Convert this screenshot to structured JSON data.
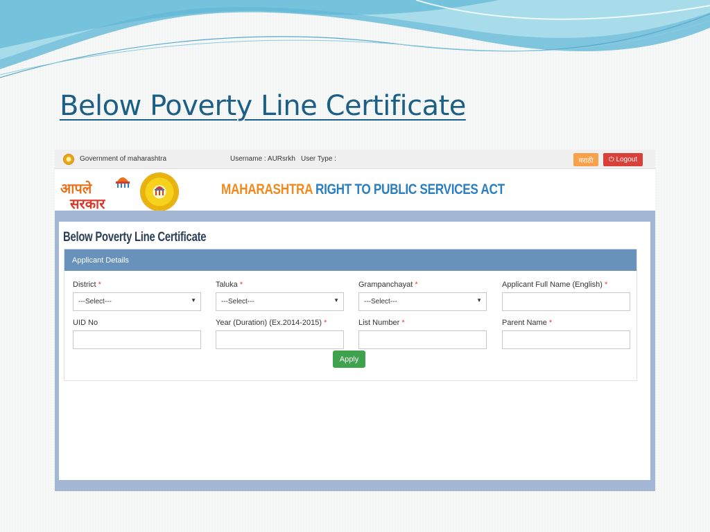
{
  "slide": {
    "title": "Below Poverty Line Certificate"
  },
  "topbar": {
    "gov_text": "Government of maharashtra",
    "username_text": "Username : AURsrkh",
    "user_type_text": "User Type :",
    "marathi_button": "मराठी",
    "logout_button": "⏻ Logout"
  },
  "brand": {
    "logo_line1": "आपले",
    "logo_line2": "सरकार",
    "tagline_orange": "MAHARASHTRA",
    "tagline_blue": " RIGHT TO PUBLIC SERVICES ACT"
  },
  "page": {
    "heading": "Below Poverty Line Certificate"
  },
  "panel": {
    "title": "Applicant Details",
    "fields": {
      "district": {
        "label": "District",
        "value": "---Select---"
      },
      "taluka": {
        "label": "Taluka",
        "value": "---Select---"
      },
      "grampanchayat": {
        "label": "Grampanchayat",
        "value": "---Select---"
      },
      "full_name": {
        "label": "Applicant Full Name (English)",
        "value": ""
      },
      "uid": {
        "label": "UID No",
        "value": ""
      },
      "year": {
        "label": "Year (Duration) (Ex.2014-2015)",
        "value": ""
      },
      "list_number": {
        "label": "List Number",
        "value": ""
      },
      "parent_name": {
        "label": "Parent Name",
        "value": ""
      }
    },
    "required_marker": "*",
    "apply_button": "Apply"
  },
  "colors": {
    "title_blue": "#1c5f86",
    "panel_header": "#6992bb",
    "apply_green": "#3fa34d",
    "logout_red": "#d9403a",
    "marathi_orange": "#f7a24a",
    "frame_blue": "#a3b6d3"
  },
  "icons": {
    "power": "power-icon",
    "dropdown": "caret-down-icon",
    "emblem": "emblem-icon"
  }
}
